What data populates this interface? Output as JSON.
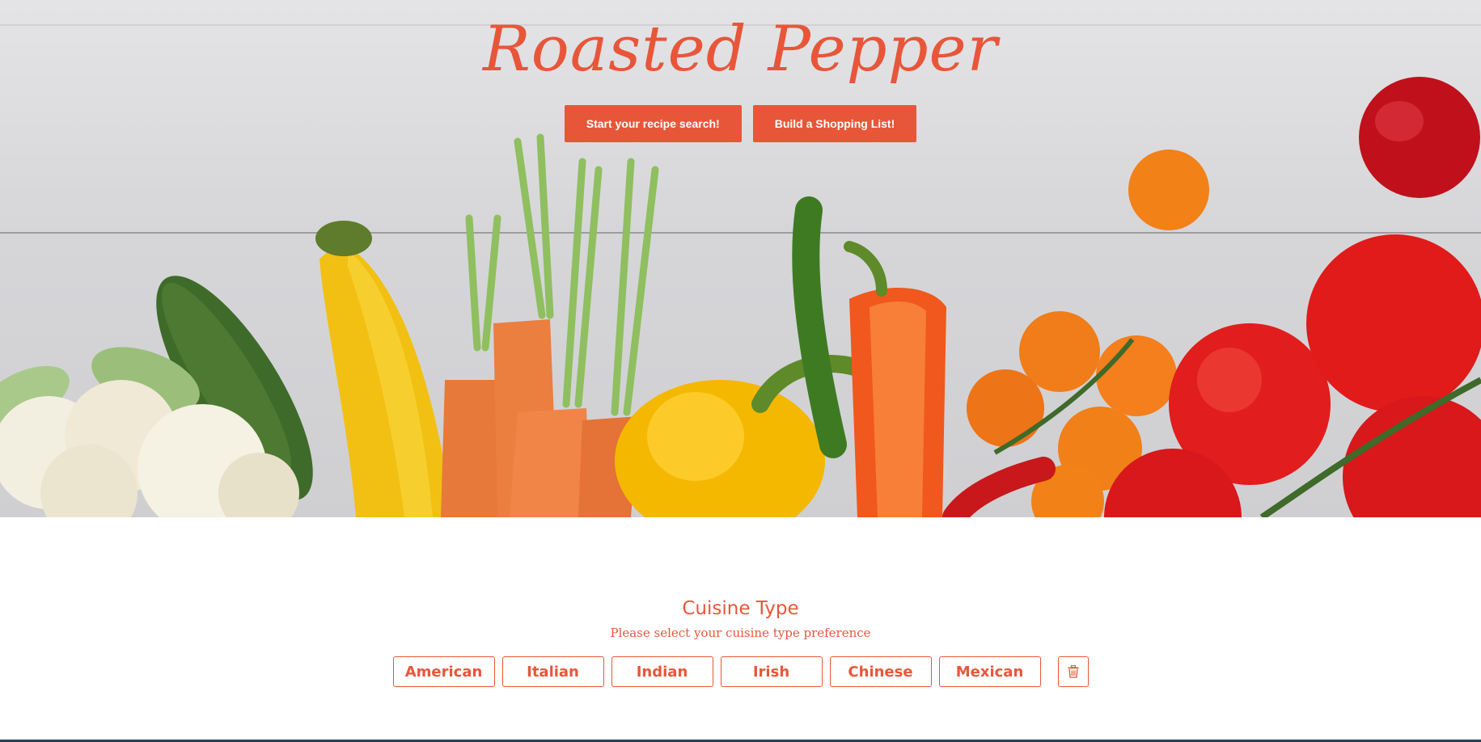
{
  "brand": {
    "name": "Roasted Pepper"
  },
  "hero": {
    "buttons": [
      {
        "label": "Start your recipe search!"
      },
      {
        "label": "Build a Shopping List!"
      }
    ],
    "image_subject": "vegetables-on-wood-table"
  },
  "cuisine": {
    "title": "Cuisine Type",
    "subtitle": "Please select your cuisine type preference",
    "options": [
      {
        "label": "American"
      },
      {
        "label": "Italian"
      },
      {
        "label": "Indian"
      },
      {
        "label": "Irish"
      },
      {
        "label": "Chinese"
      },
      {
        "label": "Mexican"
      }
    ],
    "clear_icon": "trash-icon"
  },
  "colors": {
    "accent": "#e8563a",
    "footer": "#2b3e50"
  }
}
